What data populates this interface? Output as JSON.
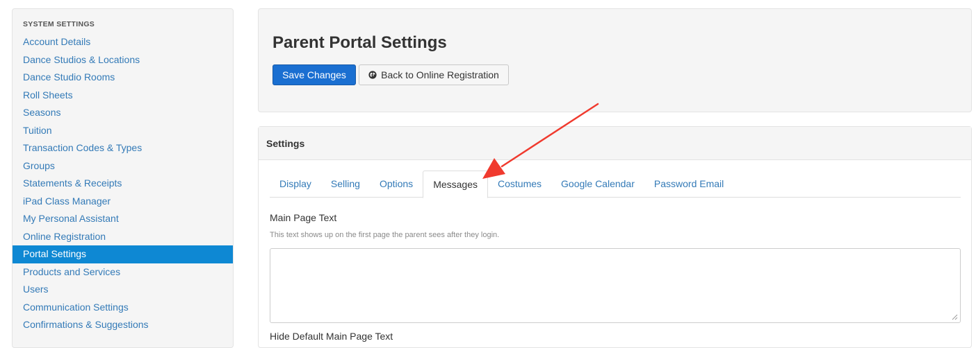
{
  "sidebar": {
    "heading": "SYSTEM SETTINGS",
    "items": [
      {
        "label": "Account Details"
      },
      {
        "label": "Dance Studios & Locations"
      },
      {
        "label": "Dance Studio Rooms"
      },
      {
        "label": "Roll Sheets"
      },
      {
        "label": "Seasons"
      },
      {
        "label": "Tuition"
      },
      {
        "label": "Transaction Codes & Types"
      },
      {
        "label": "Groups"
      },
      {
        "label": "Statements & Receipts"
      },
      {
        "label": "iPad Class Manager"
      },
      {
        "label": "My Personal Assistant"
      },
      {
        "label": "Online Registration"
      },
      {
        "label": "Portal Settings",
        "active": true
      },
      {
        "label": "Products and Services"
      },
      {
        "label": "Users"
      },
      {
        "label": "Communication Settings"
      },
      {
        "label": "Confirmations & Suggestions"
      }
    ]
  },
  "header": {
    "title": "Parent Portal Settings",
    "save_label": "Save Changes",
    "back_label": "Back to Online Registration"
  },
  "settings": {
    "heading": "Settings",
    "tabs": [
      {
        "label": "Display"
      },
      {
        "label": "Selling"
      },
      {
        "label": "Options"
      },
      {
        "label": "Messages",
        "active": true
      },
      {
        "label": "Costumes"
      },
      {
        "label": "Google Calendar"
      },
      {
        "label": "Password Email"
      }
    ],
    "main_page_text_label": "Main Page Text",
    "main_page_text_help": "This text shows up on the first page the parent sees after they login.",
    "main_page_text_value": "",
    "next_field_label": "Hide Default Main Page Text"
  },
  "colors": {
    "accent": "#0e88d3",
    "link": "#337ab7",
    "primary_button": "#1a6fd1",
    "annotation_arrow": "#f03a2e"
  },
  "icons": {
    "back_button_icon": "globe-icon"
  }
}
